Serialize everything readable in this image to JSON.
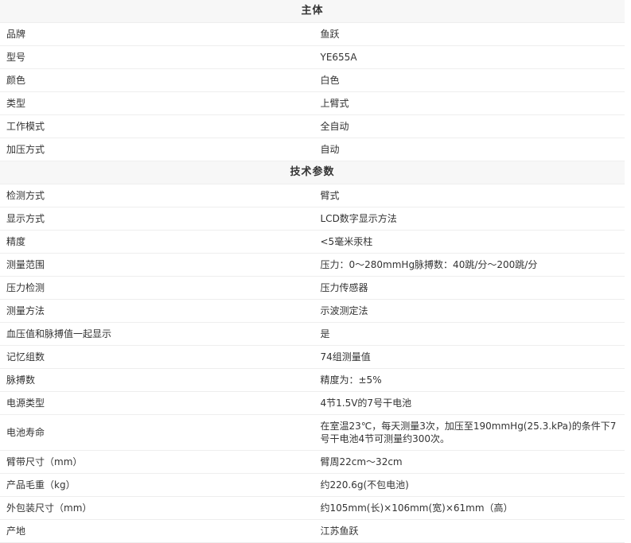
{
  "sections": [
    {
      "title": "主体",
      "rows": [
        {
          "label": "品牌",
          "value": "鱼跃"
        },
        {
          "label": "型号",
          "value": "YE655A"
        },
        {
          "label": "颜色",
          "value": "白色"
        },
        {
          "label": "类型",
          "value": "上臂式"
        },
        {
          "label": "工作模式",
          "value": "全自动"
        },
        {
          "label": "加压方式",
          "value": "自动"
        }
      ]
    },
    {
      "title": "技术参数",
      "rows": [
        {
          "label": "检测方式",
          "value": "臂式"
        },
        {
          "label": "显示方式",
          "value": "LCD数字显示方法"
        },
        {
          "label": "精度",
          "value": "<5毫米汞柱"
        },
        {
          "label": "测量范围",
          "value": "压力：0～280mmHg脉搏数：40跳/分～200跳/分"
        },
        {
          "label": "压力检测",
          "value": "压力传感器"
        },
        {
          "label": "测量方法",
          "value": "示波测定法"
        },
        {
          "label": "血压值和脉搏值一起显示",
          "value": "是"
        },
        {
          "label": "记忆组数",
          "value": "74组测量值"
        },
        {
          "label": "脉搏数",
          "value": "精度为：±5%"
        },
        {
          "label": "电源类型",
          "value": "4节1.5V的7号干电池"
        },
        {
          "label": "电池寿命",
          "value": "在室温23℃，每天测量3次，加压至190mmHg(25.3.kPa)的条件下7号干电池4节可测量约300次。"
        },
        {
          "label": "臂带尺寸（mm）",
          "value": "臂周22cm～32cm"
        },
        {
          "label": "产品毛重（kg）",
          "value": "约220.6g(不包电池)"
        },
        {
          "label": "外包装尺寸（mm）",
          "value": "约105mm(长)×106mm(宽)×61mm（高）"
        },
        {
          "label": "产地",
          "value": "江苏鱼跃"
        }
      ]
    }
  ]
}
